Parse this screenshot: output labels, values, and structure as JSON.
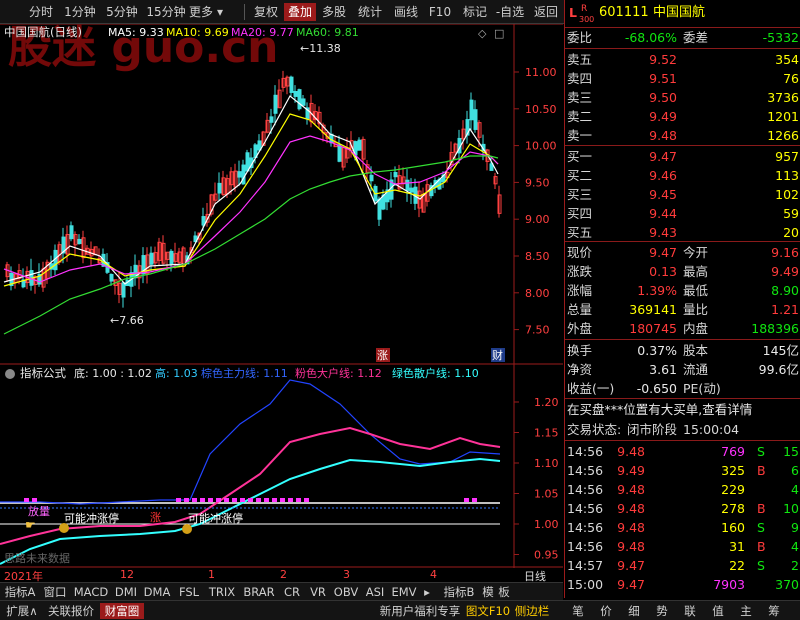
{
  "toolbar": {
    "items": [
      "分时",
      "1分钟",
      "5分钟",
      "15分钟",
      "更多",
      "复权",
      "叠加",
      "多股",
      "统计",
      "画线",
      "F10",
      "标记",
      "-自选",
      "返回"
    ]
  },
  "chart": {
    "title": "中国国航(日线)",
    "ma_labels": {
      "ma5": "MA5: 9.33",
      "ma10": "MA10: 9.69",
      "ma20": "MA20: 9.77",
      "ma60": "MA60: 9.81"
    },
    "watermark": "股迷 guo.cn",
    "high_marker": "11.38",
    "low_marker": "7.66",
    "price_axis": [
      "11.00",
      "10.50",
      "10.00",
      "9.50",
      "9.00",
      "8.50",
      "8.00",
      "7.50"
    ],
    "badges": {
      "zhang": "涨",
      "cai": "财"
    },
    "colors": {
      "up": "#ff4040",
      "down": "#40e0e0",
      "ma5": "#ffffff",
      "ma10": "#ffff00",
      "ma20": "#ff33ff",
      "ma60": "#33dd33"
    }
  },
  "indicator": {
    "name": "指标公式",
    "params": "底: 1.00 : 1.02",
    "gao": "高: 1.03",
    "blue_line": "棕色主力线: 1.11",
    "pink_line": "粉色大户线: 1.12",
    "green_line": "绿色散户线: 1.10",
    "axis": [
      "1.20",
      "1.15",
      "1.10",
      "1.05",
      "1.00",
      "0.95"
    ],
    "annotations": [
      "放量",
      "可能冲涨停",
      "涨",
      "可能冲涨停"
    ],
    "footer": "思路未来数据"
  },
  "time_axis": {
    "ticks": [
      "2021年",
      "12",
      "1",
      "2",
      "3",
      "4"
    ],
    "period": "日线"
  },
  "bottom_tabs_1": [
    "指标A",
    "窗口",
    "MACD",
    "DMI",
    "DMA",
    "FSL",
    "TRIX",
    "BRAR",
    "CR",
    "VR",
    "OBV",
    "ASI",
    "EMV",
    "指标B",
    "模",
    "板"
  ],
  "bottom_tabs_2": [
    "扩展∧",
    "关联报价",
    "财富圈",
    "新用户福利专享",
    "图文F10",
    "侧边栏",
    "笔",
    "价",
    "细",
    "势",
    "联",
    "值",
    "主",
    "筹"
  ],
  "quote": {
    "code": "601111",
    "name": "中国国航",
    "tag": "L R 300",
    "weibi_label": "委比",
    "weibi": "-68.06%",
    "weicha_label": "委差",
    "weicha": "-5332",
    "asks": [
      {
        "label": "卖五",
        "price": "9.52",
        "vol": "354"
      },
      {
        "label": "卖四",
        "price": "9.51",
        "vol": "76"
      },
      {
        "label": "卖三",
        "price": "9.50",
        "vol": "3736"
      },
      {
        "label": "卖二",
        "price": "9.49",
        "vol": "1201"
      },
      {
        "label": "卖一",
        "price": "9.48",
        "vol": "1266"
      }
    ],
    "bids": [
      {
        "label": "买一",
        "price": "9.47",
        "vol": "957"
      },
      {
        "label": "买二",
        "price": "9.46",
        "vol": "113"
      },
      {
        "label": "买三",
        "price": "9.45",
        "vol": "102"
      },
      {
        "label": "买四",
        "price": "9.44",
        "vol": "59"
      },
      {
        "label": "买五",
        "price": "9.43",
        "vol": "20"
      }
    ],
    "stats": [
      {
        "l1": "现价",
        "v1": "9.47",
        "c1": "red",
        "l2": "今开",
        "v2": "9.16",
        "c2": "red"
      },
      {
        "l1": "涨跌",
        "v1": "0.13",
        "c1": "red",
        "l2": "最高",
        "v2": "9.49",
        "c2": "red"
      },
      {
        "l1": "涨幅",
        "v1": "1.39%",
        "c1": "red",
        "l2": "最低",
        "v2": "8.90",
        "c2": "green"
      },
      {
        "l1": "总量",
        "v1": "369141",
        "c1": "yellow",
        "l2": "量比",
        "v2": "1.21",
        "c2": "red"
      },
      {
        "l1": "外盘",
        "v1": "180745",
        "c1": "red",
        "l2": "内盘",
        "v2": "188396",
        "c2": "green"
      }
    ],
    "stats2": [
      {
        "l1": "换手",
        "v1": "0.37%",
        "l2": "股本",
        "v2": "145亿"
      },
      {
        "l1": "净资",
        "v1": "3.61",
        "l2": "流通",
        "v2": "99.6亿"
      },
      {
        "l1": "收益(一)",
        "v1": "-0.650",
        "l2": "PE(动)",
        "v2": ""
      }
    ],
    "notice": "在买盘***位置有大买单,查看详情",
    "status_label": "交易状态:",
    "status": "闭市阶段",
    "status_time": "15:00:04",
    "ticks": [
      {
        "t": "14:56",
        "p": "9.48",
        "v": "769",
        "s": "S",
        "n": "15",
        "vc": "magenta",
        "sc": "green"
      },
      {
        "t": "14:56",
        "p": "9.49",
        "v": "325",
        "s": "B",
        "n": "6",
        "vc": "yellow",
        "sc": "red"
      },
      {
        "t": "14:56",
        "p": "9.48",
        "v": "229",
        "s": "",
        "n": "4",
        "vc": "yellow",
        "sc": "white"
      },
      {
        "t": "14:56",
        "p": "9.48",
        "v": "278",
        "s": "B",
        "n": "10",
        "vc": "yellow",
        "sc": "red"
      },
      {
        "t": "14:56",
        "p": "9.48",
        "v": "160",
        "s": "S",
        "n": "9",
        "vc": "yellow",
        "sc": "green"
      },
      {
        "t": "14:56",
        "p": "9.48",
        "v": "31",
        "s": "B",
        "n": "4",
        "vc": "yellow",
        "sc": "red"
      },
      {
        "t": "14:57",
        "p": "9.47",
        "v": "22",
        "s": "S",
        "n": "2",
        "vc": "yellow",
        "sc": "green"
      },
      {
        "t": "15:00",
        "p": "9.47",
        "v": "7903",
        "s": "",
        "n": "370",
        "vc": "magenta",
        "sc": "white"
      }
    ]
  }
}
